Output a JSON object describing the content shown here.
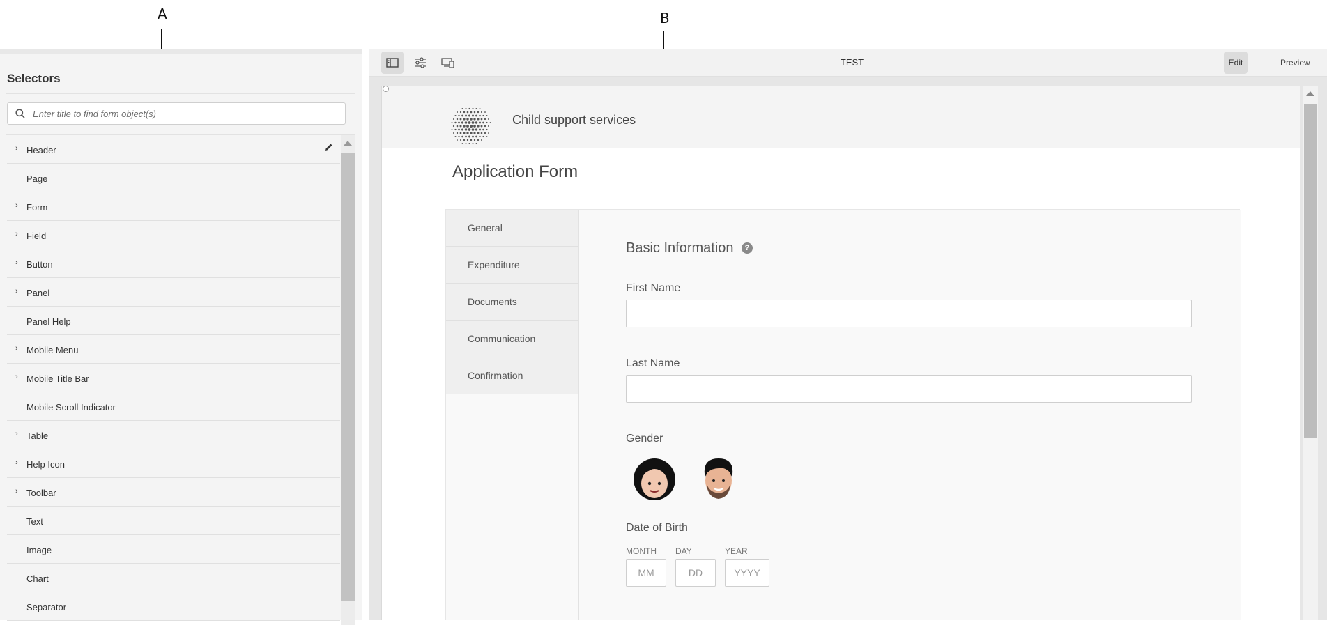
{
  "callouts": {
    "a": "A",
    "b": "B"
  },
  "selectors": {
    "title": "Selectors",
    "search_placeholder": "Enter title to find form object(s)",
    "items": [
      {
        "label": "Header",
        "expandable": true,
        "editable": true
      },
      {
        "label": "Page",
        "expandable": false
      },
      {
        "label": "Form",
        "expandable": true
      },
      {
        "label": "Field",
        "expandable": true
      },
      {
        "label": "Button",
        "expandable": true
      },
      {
        "label": "Panel",
        "expandable": true
      },
      {
        "label": "Panel Help",
        "expandable": false
      },
      {
        "label": "Mobile Menu",
        "expandable": true
      },
      {
        "label": "Mobile Title Bar",
        "expandable": true
      },
      {
        "label": "Mobile Scroll Indicator",
        "expandable": false
      },
      {
        "label": "Table",
        "expandable": true
      },
      {
        "label": "Help Icon",
        "expandable": true
      },
      {
        "label": "Toolbar",
        "expandable": true
      },
      {
        "label": "Text",
        "expandable": false
      },
      {
        "label": "Image",
        "expandable": false
      },
      {
        "label": "Chart",
        "expandable": false
      },
      {
        "label": "Separator",
        "expandable": false
      }
    ]
  },
  "toolbar": {
    "page_name": "TEST",
    "edit_label": "Edit",
    "preview_label": "Preview",
    "icons": [
      "side-panel-icon",
      "properties-sliders-icon",
      "emulator-devices-icon"
    ]
  },
  "form": {
    "site_title": "Child support services",
    "title": "Application Form",
    "tabs": [
      "General",
      "Expenditure",
      "Documents",
      "Communication",
      "Confirmation"
    ],
    "section_title": "Basic Information",
    "help_symbol": "?",
    "first_name_label": "First Name",
    "last_name_label": "Last Name",
    "gender_label": "Gender",
    "dob_label": "Date of Birth",
    "dob": {
      "month_caption": "MONTH",
      "month_placeholder": "MM",
      "day_caption": "DAY",
      "day_placeholder": "DD",
      "year_caption": "YEAR",
      "year_placeholder": "YYYY"
    }
  },
  "colors": {
    "accent": "#dcdcdc",
    "panel_bg": "#f4f4f4",
    "canvas_bg": "#e6e6e6"
  }
}
